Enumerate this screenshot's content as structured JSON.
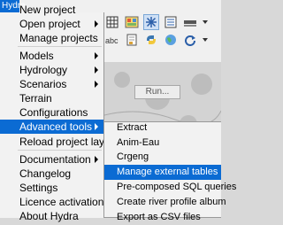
{
  "app": {
    "tab_label": "Hydra"
  },
  "toolbar": {
    "run_label": "Run...",
    "row1_icons": [
      "grid-icon",
      "dashboard-icon",
      "snowflake-icon",
      "list-icon",
      "text-icon",
      "dropdown-icon"
    ],
    "row2_icons": [
      "abc-icon",
      "document-icon",
      "python-icon",
      "earth-icon",
      "refresh-icon",
      "dropdown-icon"
    ]
  },
  "menu": {
    "items": [
      {
        "label": "New project",
        "arrow": false
      },
      {
        "label": "Open project",
        "arrow": true
      },
      {
        "label": "Manage projects",
        "arrow": false
      },
      {
        "label": "Models",
        "arrow": true
      },
      {
        "label": "Hydrology",
        "arrow": true
      },
      {
        "label": "Scenarios",
        "arrow": true
      },
      {
        "label": "Terrain",
        "arrow": false
      },
      {
        "label": "Configurations",
        "arrow": false
      },
      {
        "label": "Advanced tools",
        "arrow": true,
        "active": true
      },
      {
        "label": "Reload project layers",
        "arrow": false
      },
      {
        "label": "Documentation",
        "arrow": true
      },
      {
        "label": "Changelog",
        "arrow": false
      },
      {
        "label": "Settings",
        "arrow": false
      },
      {
        "label": "Licence activation",
        "arrow": false
      },
      {
        "label": "About Hydra",
        "arrow": false
      }
    ]
  },
  "submenu": {
    "items": [
      {
        "label": "Extract"
      },
      {
        "label": "Anim-Eau"
      },
      {
        "label": "Crgeng"
      },
      {
        "label": "Manage external tables",
        "active": true
      },
      {
        "label": "Pre-composed SQL queries"
      },
      {
        "label": "Create river profile album"
      },
      {
        "label": "Export as CSV files"
      }
    ]
  },
  "colors": {
    "accent": "#0b6bd3",
    "menu_bg": "#f2f2f2"
  }
}
